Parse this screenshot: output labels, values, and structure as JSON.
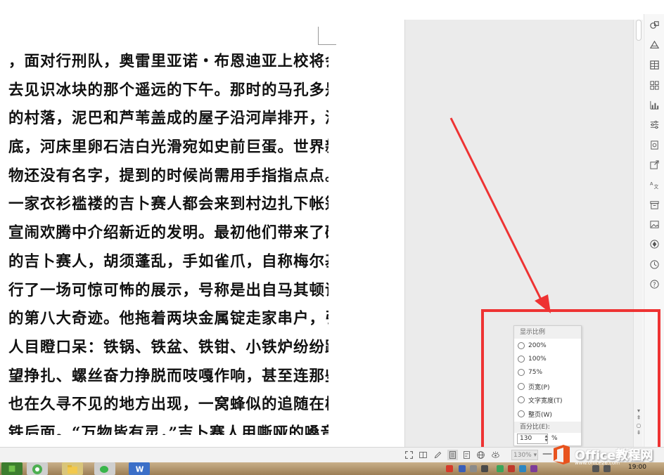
{
  "document": {
    "lines": [
      "，面对行刑队，奥雷里亚诺・布恩迪亚上校将会回",
      "去见识冰块的那个遥远的下午。那时的马孔多是一",
      "的村落，泥巴和芦苇盖成的屋子沿河岸排开，湍急",
      "底，河床里卵石洁白光滑宛如史前巨蛋。世界新生",
      "物还没有名字，提到的时候尚需用手指指点点。每",
      "一家衣衫褴褛的吉卜赛人都会来到村边扎下帐篷，",
      "宣闹欢腾中介绍新近的发明。最初他们带来了磁石。",
      "的吉卜赛人，胡须蓬乱，手如雀爪，自称梅尔基亚",
      "行了一场可惊可怖的展示，号称是出自马其顿诸位",
      "的第八大奇迹。他拖着两块金属锭走家串户，引发",
      "人目瞪口呆：铁锅、铁盆、铁钳、小铁炉纷纷跌落，",
      "望挣扎、螺丝奋力挣脱而吱嘎作响，甚至连那些丢",
      "也在久寻不见的地方出现，一窝蜂似的追随在梅尔",
      "铁后面。“万物皆有灵，”吉卜赛人用嘶哑的嗓音"
    ]
  },
  "zoom_menu": {
    "title": "显示比例",
    "options": [
      "200%",
      "100%",
      "75%",
      "页宽(P)",
      "文字宽度(T)",
      "整页(W)"
    ],
    "percent_label": "百分比(E):",
    "percent_value": "130",
    "percent_unit": "%"
  },
  "statusbar": {
    "zoom_value": "130% ▾",
    "zoom_minus": "—"
  },
  "taskbar": {
    "time": "19:00"
  },
  "watermark": {
    "text": "Office教程网",
    "url": "www.office26.com"
  },
  "colors": {
    "highlight": "#ee3333",
    "arrow": "#ee3333",
    "watermark_logo": "#e8531e"
  }
}
